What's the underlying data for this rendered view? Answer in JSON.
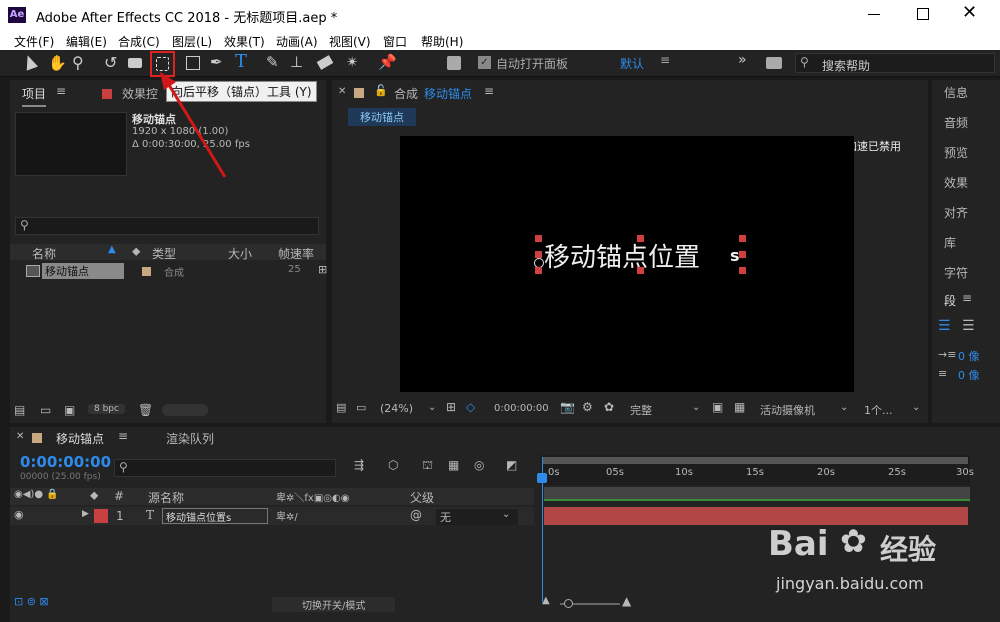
{
  "app": {
    "logo": "Ae",
    "title": "Adobe After Effects CC 2018 - 无标题项目.aep *"
  },
  "menu": [
    "文件(F)",
    "编辑(E)",
    "合成(C)",
    "图层(L)",
    "效果(T)",
    "动画(A)",
    "视图(V)",
    "窗口",
    "帮助(H)"
  ],
  "toolbar": {
    "tooltip": "向后平移（锚点）工具 (Y)",
    "auto_open": "自动打开面板",
    "workspace": "默认",
    "search_placeholder": "搜索帮助"
  },
  "project": {
    "tab": "项目",
    "effects_tab": "效果控",
    "comp_name": "移动锚点",
    "comp_res": "1920 x 1080 (1.00)",
    "comp_dur": "Δ 0:00:30:00, 25.00 fps",
    "columns": [
      "名称",
      "类型",
      "大小",
      "帧速率"
    ],
    "row": {
      "name": "移动锚点",
      "type": "合成",
      "fps": "25"
    },
    "bpc": "8 bpc"
  },
  "comp": {
    "tab_prefix": "合成",
    "tab_name": "移动锚点",
    "breadcrumb": "移动锚点",
    "accel": "显示加速已禁用",
    "text": "移动锚点位置",
    "zoom": "(24%)",
    "time": "0:00:00:00",
    "quality": "完整",
    "camera": "活动摄像机",
    "views": "1个..."
  },
  "right_panels": [
    "信息",
    "音频",
    "预览",
    "效果",
    "对齐",
    "库",
    "字符",
    "段"
  ],
  "paragraph": {
    "indent1": "0 像",
    "indent2": "0 像"
  },
  "timeline": {
    "tab": "移动锚点",
    "render_tab": "渲染队列",
    "timecode": "0:00:00:00",
    "frames": "00000 (25.00 fps)",
    "col_num": "#",
    "col_source": "源名称",
    "col_parent": "父级",
    "ruler": [
      "0s",
      "05s",
      "10s",
      "15s",
      "20s",
      "25s",
      "30s"
    ],
    "layer": {
      "num": "1",
      "type_icon": "T",
      "name": "移动锚点位置s",
      "parent": "无"
    },
    "toggle": "切换开关/模式"
  },
  "watermark": {
    "brand": "Bai",
    "brand2": "经验",
    "url": "jingyan.baidu.com"
  },
  "colors": {
    "accent": "#2d8ceb",
    "label_red": "#c84040",
    "bar_red": "#b24545",
    "tooltip_border": "#d22",
    "arrow": "#d01818"
  }
}
